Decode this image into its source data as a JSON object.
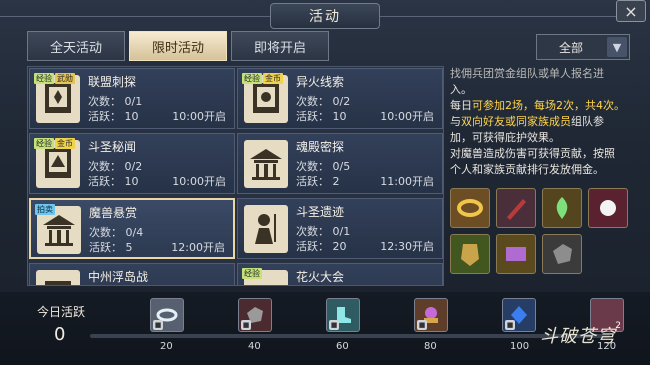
{
  "window": {
    "title": "活动",
    "close_icon": "×"
  },
  "tabs": [
    {
      "label": "全天活动",
      "active": false
    },
    {
      "label": "限时活动",
      "active": true
    },
    {
      "label": "即将开启",
      "active": false
    }
  ],
  "filter": {
    "value": "全部",
    "arrow": "▼"
  },
  "activities": [
    {
      "name": "联盟刺探",
      "tags": [
        "经验",
        "武勋"
      ],
      "count": "次数：  0/1",
      "active": "活跃：  10",
      "time": "10:00开启",
      "selected": false
    },
    {
      "name": "异火线索",
      "tags": [
        "经验",
        "金币"
      ],
      "count": "次数：  0/2",
      "active": "活跃：  10",
      "time": "10:00开启",
      "selected": false
    },
    {
      "name": "斗圣秘闻",
      "tags": [
        "经验",
        "金币"
      ],
      "count": "次数：  0/2",
      "active": "活跃：  10",
      "time": "10:00开启",
      "selected": false
    },
    {
      "name": "魂殿密探",
      "tags": [],
      "count": "次数：  0/5",
      "active": "活跃：  2",
      "time": "11:00开启",
      "selected": false
    },
    {
      "name": "魔兽悬赏",
      "tags": [
        "拍卖"
      ],
      "count": "次数：  0/4",
      "active": "活跃：  5",
      "time": "12:00开启",
      "selected": true
    },
    {
      "name": "斗圣遗迹",
      "tags": [],
      "count": "次数：  0/1",
      "active": "活跃：  20",
      "time": "12:30开启",
      "selected": false
    },
    {
      "name": "中州浮岛战",
      "tags": [],
      "count": "",
      "active": "",
      "time": "",
      "selected": false
    },
    {
      "name": "花火大会",
      "tags": [
        "经验"
      ],
      "count": "",
      "active": "",
      "time": "",
      "selected": false
    }
  ],
  "info": {
    "line0": "找佣兵团赏金组队或单人报名进",
    "line1": "入。",
    "line2a": "每日",
    "line2b": "可参加2场，每场2次，共4次。",
    "line3a": "与",
    "line3b": "双向好友或同家族成员",
    "line3c": "组队参",
    "line4": "加，可获得庇护效果。",
    "line5": "对魔兽造成伤害可获得贡献，按照",
    "line6": "个人和家族贡献排行发放佣金。"
  },
  "rewards_icons": [
    "ring-icon",
    "sword-icon",
    "green-flame-icon",
    "pearl-icon",
    "armor-icon",
    "scroll-icon",
    "stone-icon"
  ],
  "bottom": {
    "today_label": "今日活跃",
    "today_value": "0",
    "milestones": [
      "20",
      "40",
      "60",
      "80",
      "100",
      "120"
    ],
    "last_badge": "2",
    "logo": "斗破苍穹"
  }
}
